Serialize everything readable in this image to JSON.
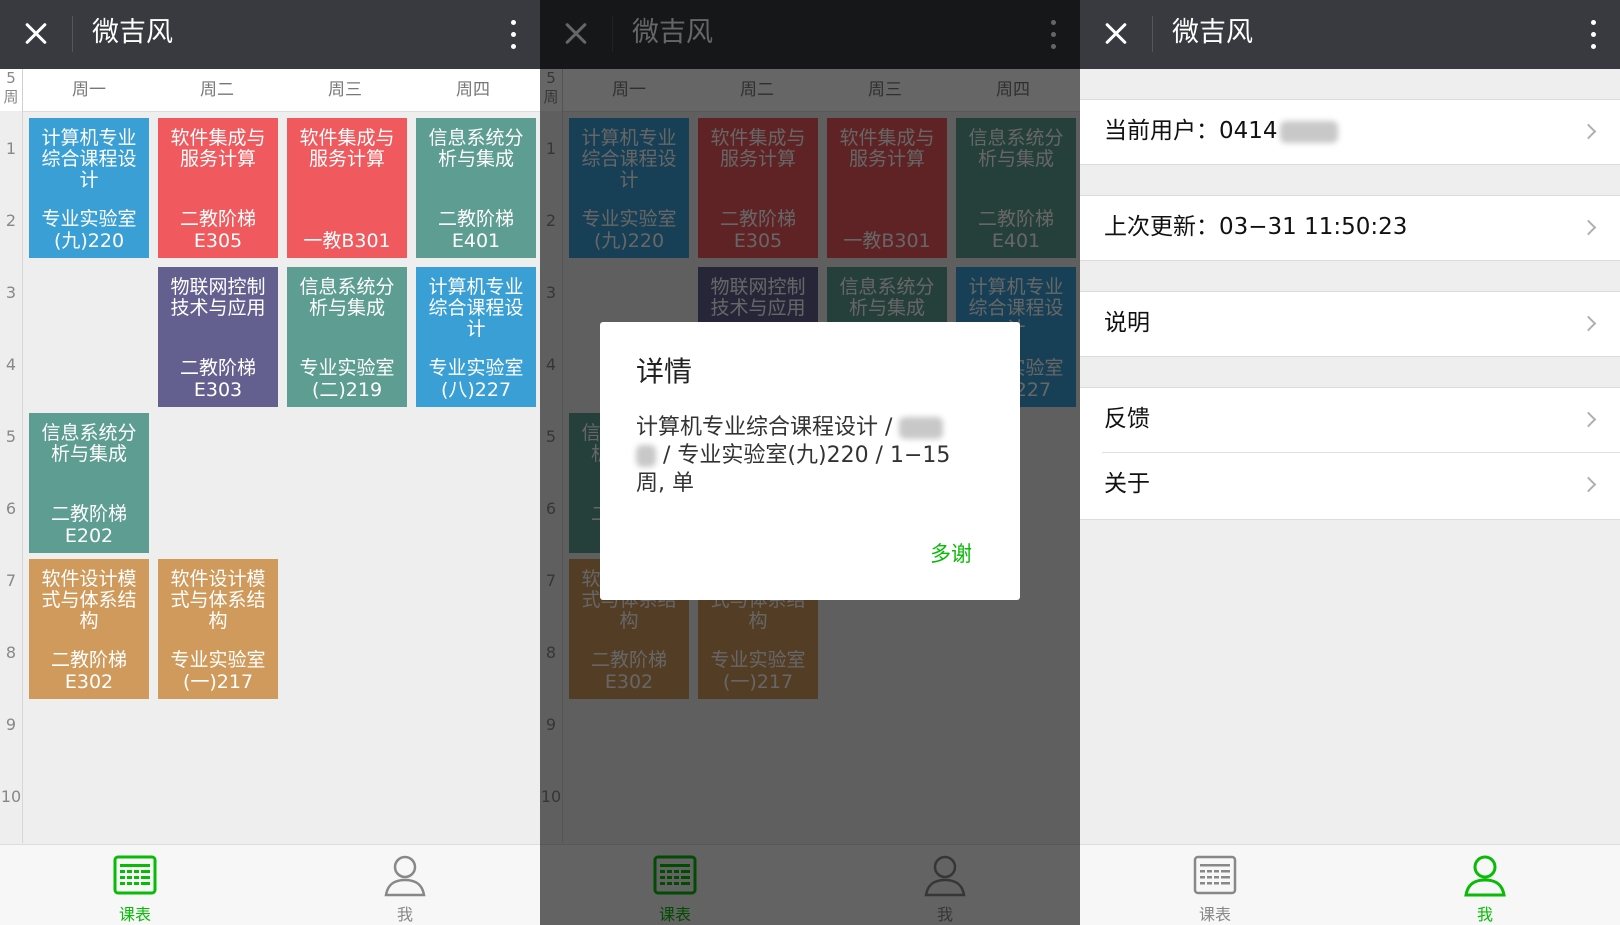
{
  "app": {
    "title": "微吉风"
  },
  "timetable": {
    "week_number": "5",
    "week_unit": "周",
    "days": [
      "周一",
      "周二",
      "周三",
      "周四"
    ],
    "periods": [
      "1",
      "2",
      "3",
      "4",
      "5",
      "6",
      "7",
      "8",
      "9",
      "10"
    ],
    "courses": [
      {
        "name": "计算机专业综合课程设计",
        "room": "专业实验室(九)220",
        "day": 0,
        "start": 1,
        "end": 2,
        "color": "#3a9fd4"
      },
      {
        "name": "软件集成与服务计算",
        "room": "二教阶梯E305",
        "day": 1,
        "start": 1,
        "end": 2,
        "color": "#f0595d"
      },
      {
        "name": "软件集成与服务计算",
        "room": "一教B301",
        "day": 2,
        "start": 1,
        "end": 2,
        "color": "#f0595d"
      },
      {
        "name": "信息系统分析与集成",
        "room": "二教阶梯E401",
        "day": 3,
        "start": 1,
        "end": 2,
        "color": "#5d9d92"
      },
      {
        "name": "物联网控制技术与应用",
        "room": "二教阶梯E303",
        "day": 1,
        "start": 3,
        "end": 4,
        "color": "#635f8f"
      },
      {
        "name": "信息系统分析与集成",
        "room": "专业实验室(二)219",
        "day": 2,
        "start": 3,
        "end": 4,
        "color": "#5d9d92"
      },
      {
        "name": "计算机专业综合课程设计",
        "room": "专业实验室(八)227",
        "day": 3,
        "start": 3,
        "end": 4,
        "color": "#3a9fd4"
      },
      {
        "name": "信息系统分析与集成",
        "room": "二教阶梯E202",
        "day": 0,
        "start": 5,
        "end": 6,
        "color": "#5d9d92"
      },
      {
        "name": "软件设计模式与体系结构",
        "room": "二教阶梯E302",
        "day": 0,
        "start": 7,
        "end": 8,
        "color": "#d09a5c"
      },
      {
        "name": "软件设计模式与体系结构",
        "room": "专业实验室(一)217",
        "day": 1,
        "start": 7,
        "end": 8,
        "color": "#d09a5c"
      }
    ]
  },
  "dialog": {
    "title": "详情",
    "line1": "计算机专业综合课程设计 /",
    "line2": "/ 专业实验室(九)220 / 1−15",
    "line3": "周, 单",
    "button": "多谢"
  },
  "profile": {
    "current_user": "当前用户：0414",
    "last_update": "上次更新：03−31 11:50:23",
    "instructions": "说明",
    "feedback": "反馈",
    "about": "关于"
  },
  "tabs": {
    "schedule": "课表",
    "me": "我"
  },
  "colors": {
    "accent": "#09bb07",
    "inactive": "#888888",
    "topbar": "#393a3f"
  }
}
